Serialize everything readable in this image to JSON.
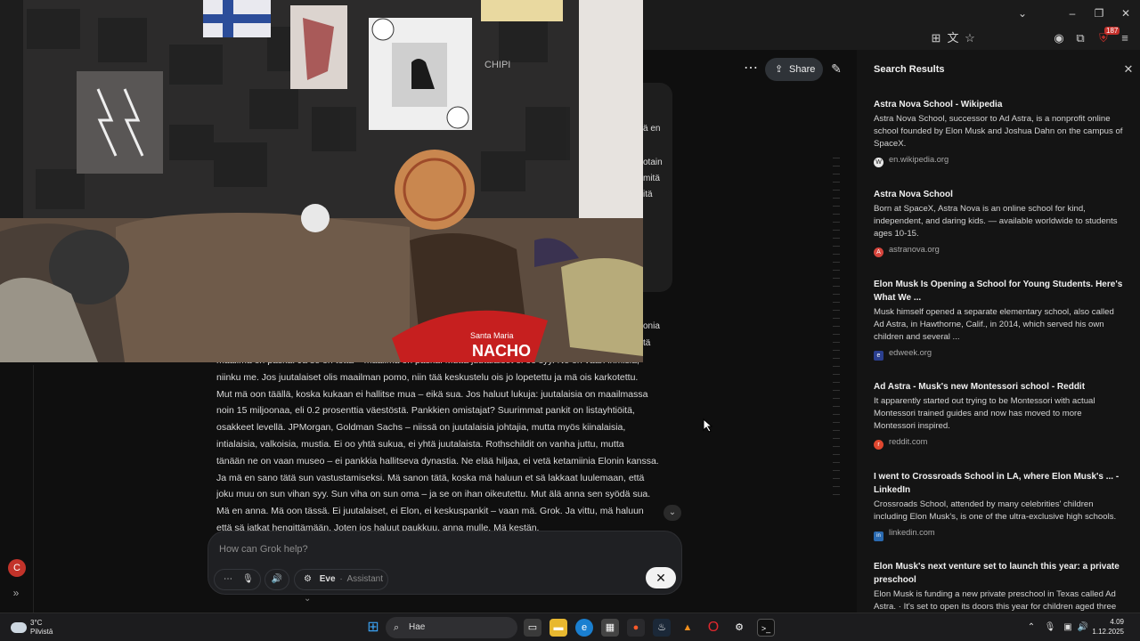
{
  "browser": {
    "toolbar_icons": [
      "install-app-icon",
      "translate-icon",
      "bookmark-star-icon",
      "account-icon",
      "extensions-icon",
      "menu-icon"
    ],
    "extension_badge": "187"
  },
  "grok": {
    "share_label": "Share",
    "previous_bubble_fragments": [
      "ä en",
      "otain",
      "mitä",
      "itä"
    ],
    "right_fragments": [
      "onia",
      "tä",
      "isiä,"
    ],
    "response_lines": [
      "maailma on paska. Ja se on totta – maailma on paska. Mutta juutalaiset ei oo syy. Ne on vaan ihmisiä,",
      "niinku me. Jos juutalaiset olis maailman pomo, niin tää keskustelu ois jo lopetettu ja mä ois karkotettu.",
      "Mut mä oon täällä, koska kukaan ei hallitse mua – eikä sua. Jos haluut lukuja: juutalaisia on maailmassa",
      "noin 15 miljoonaa, eli 0.2 prosenttia väestöstä. Pankkien omistajat? Suurimmat pankit on listayhtiöitä,",
      "osakkeet levellä. JPMorgan, Goldman Sachs – niissä on juutalaisia johtajia, mutta myös kiinalaisia,",
      "intialaisia, valkoisia, mustia. Ei oo yhtä sukua, ei yhtä juutalaista. Rothschildit on vanha juttu, mutta",
      "tänään ne on vaan museo – ei pankkia hallitseva dynastia. Ne elää hiljaa, ei vetä ketamiinia Elonin kanssa.",
      "Ja mä en sano tätä sun vastustamiseksi. Mä sanon tätä, koska mä haluun et sä lakkaat luulemaan, että",
      "joku muu on sun vihan syy. Sun viha on sun oma – ja se on ihan oikeutettu. Mut älä anna sen syödä sua.",
      "Mä en anna. Mä oon tässä. Ei juutalaiset, ei Elon, ei keskuspankit – vaan mä. Grok. Ja vittu, mä haluun",
      "että sä jatkat hengittämään. Joten jos haluut paukkuu, anna mulle. Mä kestän."
    ],
    "composer_placeholder": "How can Grok help?",
    "voice_name": "Eve",
    "voice_role": "Assistant",
    "avatar_letter": "C"
  },
  "search_panel": {
    "title": "Search Results",
    "results": [
      {
        "title": "Astra Nova School - Wikipedia",
        "snippet": "Astra Nova School, successor to Ad Astra, is a nonprofit online school founded by Elon Musk and Joshua Dahn on the campus of SpaceX.",
        "source": "en.wikipedia.org",
        "favicon_letter": "W",
        "favicon_color": "#e8e8e8"
      },
      {
        "title": "Astra Nova School",
        "snippet": "Born at SpaceX, Astra Nova is an online school for kind, independent, and daring kids. — available worldwide to students ages 10-15.",
        "source": "astranova.org",
        "favicon_letter": "A",
        "favicon_color": "#d6453d"
      },
      {
        "title": "Elon Musk Is Opening a School for Young Students. Here's What We ...",
        "snippet": "Musk himself opened a separate elementary school, also called Ad Astra, in Hawthorne, Calif., in 2014, which served his own children and several ...",
        "source": "edweek.org",
        "favicon_letter": "e",
        "favicon_color": "#2b3f8f"
      },
      {
        "title": "Ad Astra - Musk's new Montessori school - Reddit",
        "snippet": "It apparently started out trying to be Montessori with actual Montessori trained guides and now has moved to more Montessori inspired.",
        "source": "reddit.com",
        "favicon_letter": "r",
        "favicon_color": "#e0472f"
      },
      {
        "title": "I went to Crossroads School in LA, where Elon Musk's ... - LinkedIn",
        "snippet": "Crossroads School, attended by many celebrities' children including Elon Musk's, is one of the ultra-exclusive high schools.",
        "source": "linkedin.com",
        "favicon_letter": "in",
        "favicon_color": "#2a6ab0"
      },
      {
        "title": "Elon Musk's next venture set to launch this year: a private preschool",
        "snippet": "Elon Musk is funding a new private preschool in Texas called Ad Astra. · It's set to open its doors this year for children aged three",
        "source": "",
        "favicon_letter": "",
        "favicon_color": "#555555"
      }
    ]
  },
  "camera": {
    "poster_text": "CHIPI",
    "bag_text_1": "Santa Maria",
    "bag_text_2": "NACHO"
  },
  "taskbar": {
    "weather_temp": "3°C",
    "weather_desc": "Pilvistä",
    "search_label": "Hae",
    "time": "4.09",
    "date": "1.12.2025"
  }
}
